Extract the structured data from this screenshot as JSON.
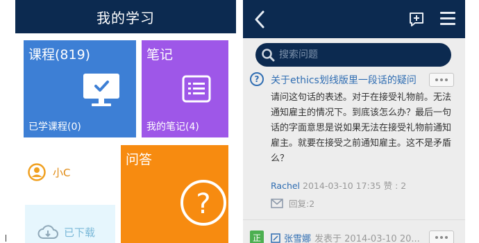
{
  "left": {
    "header_title": "我的学习",
    "tiles": {
      "course": {
        "title": "课程(819)",
        "sub": "已学课程(0)",
        "color": "#3d7fd5"
      },
      "notes": {
        "title": "笔记",
        "sub": "我的笔记(4)",
        "color": "#9e57e8"
      },
      "user": {
        "name": "小C"
      },
      "qa": {
        "title": "问答",
        "color": "#f78b10"
      },
      "downloads": {
        "label": "已下载"
      }
    }
  },
  "right": {
    "search": {
      "placeholder": "搜索问题"
    },
    "question": {
      "title": "关于ethics划线版里一段话的疑问",
      "body": "请问这句话的表述。对于在接受礼物前。无法通知雇主的情况下。到底该怎么办？最后一句话的字面意思是说如果无法在接受礼物前通知雇主。就要在接受之前通知雇主。这不是矛盾么？",
      "author": "Rachel",
      "datetime": "2014-03-10 17:35",
      "likes": "赞 : 2",
      "replies": "回复:2"
    },
    "answer": {
      "badge": "正",
      "name": "张雪娜",
      "meta": "发表于 2014-03-10 20..."
    }
  },
  "colors": {
    "header": "#0c2a50",
    "link": "#2f6db2"
  }
}
